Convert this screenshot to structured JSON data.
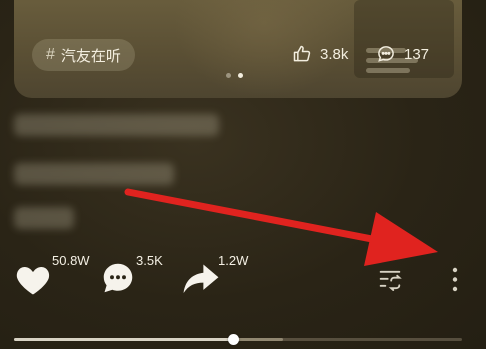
{
  "card": {
    "tag_label": "汽友在听",
    "likes_count": "3.8k",
    "comments_count": "137",
    "page_dots": 2,
    "active_dot": 1
  },
  "actions": {
    "like_count": "50.8W",
    "comment_count": "3.5K",
    "share_count": "1.2W"
  },
  "progress": {
    "played_fraction": 0.49,
    "buffered_fraction": 0.6
  },
  "colors": {
    "background": "#2a2416",
    "card": "#5a4f34",
    "annotation_arrow": "#e0231f",
    "text": "#f2efe6"
  },
  "icons": [
    "hash-icon",
    "thumbs-up-icon",
    "comment-bubble-icon",
    "heart-icon",
    "chat-bubble-icon",
    "share-arrow-icon",
    "playlist-loop-icon",
    "more-vertical-icon"
  ]
}
